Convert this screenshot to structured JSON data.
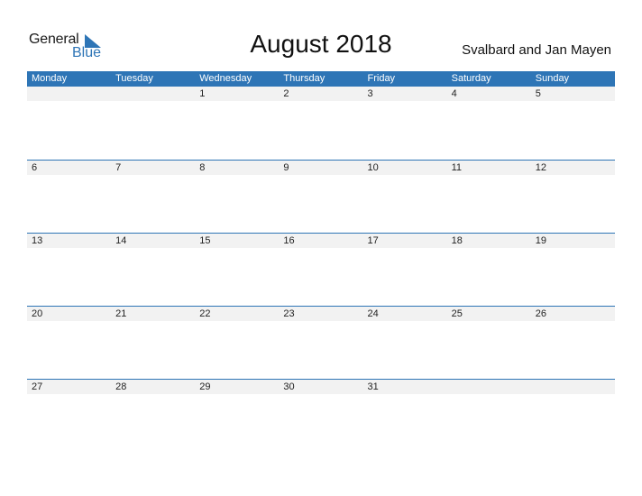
{
  "logo": {
    "line1": "General",
    "line2": "Blue"
  },
  "title": "August 2018",
  "country": "Svalbard and Jan Mayen",
  "colors": {
    "accent": "#2e75b6",
    "date_strip": "#f2f2f2"
  },
  "weekdays": [
    "Monday",
    "Tuesday",
    "Wednesday",
    "Thursday",
    "Friday",
    "Saturday",
    "Sunday"
  ],
  "weeks": [
    [
      "",
      "",
      "1",
      "2",
      "3",
      "4",
      "5"
    ],
    [
      "6",
      "7",
      "8",
      "9",
      "10",
      "11",
      "12"
    ],
    [
      "13",
      "14",
      "15",
      "16",
      "17",
      "18",
      "19"
    ],
    [
      "20",
      "21",
      "22",
      "23",
      "24",
      "25",
      "26"
    ],
    [
      "27",
      "28",
      "29",
      "30",
      "31",
      "",
      ""
    ]
  ]
}
